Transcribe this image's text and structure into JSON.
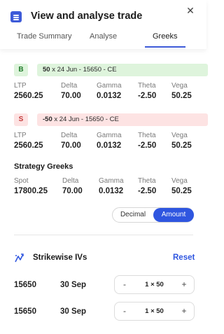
{
  "header": {
    "title": "View and analyse trade",
    "close_glyph": "✕",
    "tabs": [
      {
        "label": "Trade Summary"
      },
      {
        "label": "Analyse"
      },
      {
        "label": "Greeks",
        "active": true
      }
    ]
  },
  "legs": [
    {
      "side": "B",
      "qty": "50",
      "desc": " x 24 Jun - 15650 - CE",
      "greeks": {
        "ltp": "2560.25",
        "delta": "70.00",
        "gamma": "0.0132",
        "theta": "-2.50",
        "vega": "50.25"
      }
    },
    {
      "side": "S",
      "qty": "-50",
      "desc": " x 24 Jun - 15650 - CE",
      "greeks": {
        "ltp": "2560.25",
        "delta": "70.00",
        "gamma": "0.0132",
        "theta": "-2.50",
        "vega": "50.25"
      }
    }
  ],
  "labels": {
    "ltp": "LTP",
    "delta": "Delta",
    "gamma": "Gamma",
    "theta": "Theta",
    "vega": "Vega",
    "spot": "Spot"
  },
  "strategy_greeks": {
    "title": "Strategy Greeks",
    "spot": "17800.25",
    "delta": "70.00",
    "gamma": "0.0132",
    "theta": "-2.50",
    "vega": "50.25"
  },
  "toggle": {
    "options": [
      "Decimal",
      "Amount"
    ],
    "selected": "Amount"
  },
  "strikewise_ivs": {
    "title": "Strikewise IVs",
    "reset_label": "Reset",
    "icon": "trend-icon",
    "rows": [
      {
        "strike": "15650",
        "date": "30 Sep",
        "qty": "1 × 50",
        "minus": "-",
        "plus": "+"
      },
      {
        "strike": "15650",
        "date": "30 Sep",
        "qty": "1 × 50",
        "minus": "-",
        "plus": "+"
      }
    ]
  },
  "colors": {
    "accent": "#2f56e0",
    "buy_bg": "#def4dc",
    "sell_bg": "#fde3e3"
  }
}
